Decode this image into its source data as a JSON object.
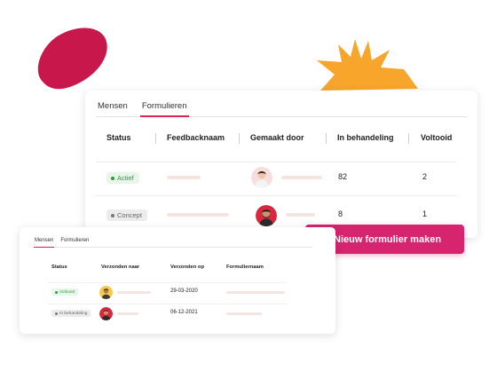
{
  "main_table": {
    "tabs": [
      "Mensen",
      "Formulieren"
    ],
    "active_tab": 1,
    "columns": [
      "Status",
      "Feedbacknaam",
      "Gemaakt door",
      "In behandeling",
      "Voltooid"
    ],
    "rows": [
      {
        "status": "Actief",
        "status_type": "active",
        "in_behandeling": "82",
        "voltooid": "2"
      },
      {
        "status": "Concept",
        "status_type": "concept",
        "in_behandeling": "8",
        "voltooid": "1"
      }
    ]
  },
  "new_form_button": {
    "label": "Nieuw formulier maken",
    "icon": "plus-icon"
  },
  "small_table": {
    "tabs": [
      "Mensen",
      "Formulieren"
    ],
    "active_tab": 0,
    "columns": [
      "Status",
      "Verzonden naar",
      "Verzonden op",
      "Formuliernaam"
    ],
    "rows": [
      {
        "status": "Voltooid",
        "status_type": "active",
        "verzonden_op": "29-03-2020"
      },
      {
        "status": "In behandeling",
        "status_type": "pending",
        "verzonden_op": "06-12-2021"
      }
    ]
  },
  "colors": {
    "accent": "#d6246e",
    "tab_underline": "#d9254f",
    "blob_red": "#c8174a",
    "blob_star": "#f7a52b",
    "active_green": "#2e9a3f"
  }
}
